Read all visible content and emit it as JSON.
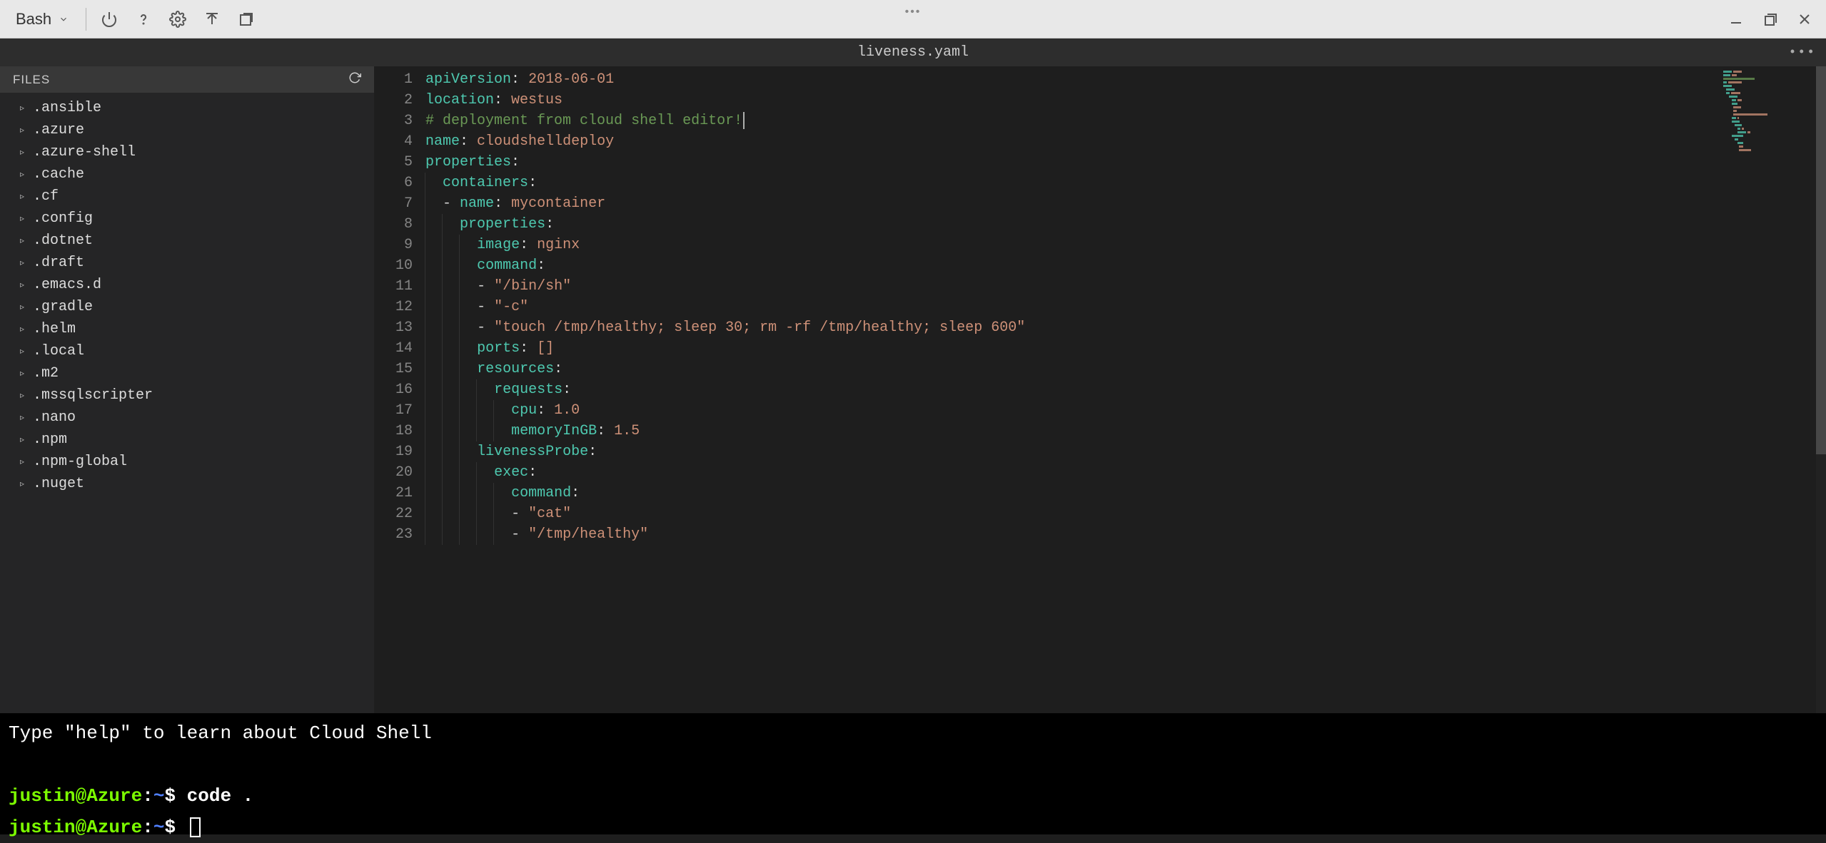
{
  "toolbar": {
    "shell_label": "Bash",
    "icons": {
      "power": "power-icon",
      "help": "help-icon",
      "settings": "gear-icon",
      "upload": "upload-icon",
      "new_window": "new-window-icon",
      "minimize": "minimize-icon",
      "restore": "restore-icon",
      "close": "close-icon"
    }
  },
  "editor": {
    "filename": "liveness.yaml",
    "sidebar_title": "FILES"
  },
  "files": [
    ".ansible",
    ".azure",
    ".azure-shell",
    ".cache",
    ".cf",
    ".config",
    ".dotnet",
    ".draft",
    ".emacs.d",
    ".gradle",
    ".helm",
    ".local",
    ".m2",
    ".mssqlscripter",
    ".nano",
    ".npm",
    ".npm-global",
    ".nuget"
  ],
  "code_lines": [
    {
      "n": 1,
      "indent": 0,
      "type": "kv",
      "key": "apiVersion",
      "val": "2018-06-01",
      "valclass": "tk-num"
    },
    {
      "n": 2,
      "indent": 0,
      "type": "kv",
      "key": "location",
      "val": "westus"
    },
    {
      "n": 3,
      "indent": 0,
      "type": "comment",
      "text": "# deployment from cloud shell editor!",
      "cursor": true
    },
    {
      "n": 4,
      "indent": 0,
      "type": "kv",
      "key": "name",
      "val": "cloudshelldeploy"
    },
    {
      "n": 5,
      "indent": 0,
      "type": "key",
      "key": "properties"
    },
    {
      "n": 6,
      "indent": 1,
      "type": "key",
      "key": "containers"
    },
    {
      "n": 7,
      "indent": 1,
      "type": "listkv",
      "key": "name",
      "val": "mycontainer"
    },
    {
      "n": 8,
      "indent": 2,
      "type": "key",
      "key": "properties"
    },
    {
      "n": 9,
      "indent": 3,
      "type": "kv",
      "key": "image",
      "val": "nginx"
    },
    {
      "n": 10,
      "indent": 3,
      "type": "key",
      "key": "command"
    },
    {
      "n": 11,
      "indent": 3,
      "type": "liststr",
      "val": "\"/bin/sh\""
    },
    {
      "n": 12,
      "indent": 3,
      "type": "liststr",
      "val": "\"-c\""
    },
    {
      "n": 13,
      "indent": 3,
      "type": "liststr",
      "val": "\"touch /tmp/healthy; sleep 30; rm -rf /tmp/healthy; sleep 600\""
    },
    {
      "n": 14,
      "indent": 3,
      "type": "kv",
      "key": "ports",
      "val": "[]"
    },
    {
      "n": 15,
      "indent": 3,
      "type": "key",
      "key": "resources"
    },
    {
      "n": 16,
      "indent": 4,
      "type": "key",
      "key": "requests"
    },
    {
      "n": 17,
      "indent": 5,
      "type": "kv",
      "key": "cpu",
      "val": "1.0",
      "valclass": "tk-num"
    },
    {
      "n": 18,
      "indent": 5,
      "type": "kv",
      "key": "memoryInGB",
      "val": "1.5",
      "valclass": "tk-num"
    },
    {
      "n": 19,
      "indent": 3,
      "type": "key",
      "key": "livenessProbe"
    },
    {
      "n": 20,
      "indent": 4,
      "type": "key",
      "key": "exec"
    },
    {
      "n": 21,
      "indent": 5,
      "type": "key",
      "key": "command"
    },
    {
      "n": 22,
      "indent": 5,
      "type": "liststr",
      "val": "\"cat\""
    },
    {
      "n": 23,
      "indent": 5,
      "type": "liststr",
      "val": "\"/tmp/healthy\""
    }
  ],
  "terminal": {
    "help_line": "Type \"help\" to learn about Cloud Shell",
    "prompt_user": "justin@Azure",
    "prompt_path": "~",
    "lines": [
      {
        "cmd": "code ."
      },
      {
        "cmd": ""
      }
    ]
  }
}
